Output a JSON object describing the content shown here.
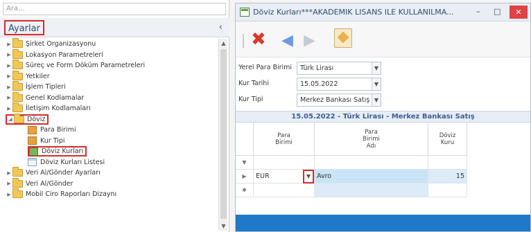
{
  "left": {
    "search_placeholder": "Ara...",
    "panel_title": "Ayarlar",
    "collapse_glyph": "‹",
    "tree": [
      {
        "label": "Şirket Organizasyonu",
        "kind": "folder",
        "expanded": false
      },
      {
        "label": "Lokasyon Parametreleri",
        "kind": "folder",
        "expanded": false
      },
      {
        "label": "Süreç ve Form Döküm Parametreleri",
        "kind": "folder",
        "expanded": false
      },
      {
        "label": "Yetkiler",
        "kind": "folder",
        "expanded": false
      },
      {
        "label": "İşlem Tipleri",
        "kind": "folder",
        "expanded": false
      },
      {
        "label": "Genel Kodlamalar",
        "kind": "folder",
        "expanded": false
      },
      {
        "label": "İletişim Kodlamaları",
        "kind": "folder",
        "expanded": false
      },
      {
        "label": "Döviz",
        "kind": "folder",
        "expanded": true
      },
      {
        "label": "Para Birimi",
        "kind": "leaf",
        "icon": "orange"
      },
      {
        "label": "Kur Tipi",
        "kind": "leaf",
        "icon": "orange"
      },
      {
        "label": "Döviz Kurları",
        "kind": "leaf",
        "icon": "green"
      },
      {
        "label": "Döviz Kurları Listesi",
        "kind": "leaf",
        "icon": "list"
      },
      {
        "label": "Veri Al/Gönder Ayarları",
        "kind": "folder",
        "expanded": false
      },
      {
        "label": "Veri Al/Gönder",
        "kind": "folder",
        "expanded": false
      },
      {
        "label": "Mobil Ciro Raporları Dizaynı",
        "kind": "folder",
        "expanded": false
      }
    ]
  },
  "window": {
    "title": "Döviz Kurları***AKADEMIK LISANS ILE KULLANILMA...",
    "min_glyph": "–",
    "max_glyph": "□",
    "close_glyph": "✕",
    "toolbar": {
      "delete_icon": "delete-x-icon",
      "prev_icon": "arrow-left-icon",
      "next_icon": "arrow-right-icon",
      "wizard_icon": "wand-icon"
    },
    "form": {
      "yerel_label": "Yerel Para Birimi",
      "yerel_value": "Türk Lirası",
      "tarih_label": "Kur Tarihi",
      "tarih_value": "15.05.2022",
      "tip_label": "Kur Tipi",
      "tip_value": "Merkez Bankası Satış",
      "dd_glyph": "▼"
    },
    "grid_caption": "15.05.2022 - Türk Lirası - Merkez Bankası Satış",
    "columns": [
      "Para Birimi",
      "Para Birimi Adı",
      "Döviz Kuru"
    ],
    "filter_glyph": "▼",
    "rows": [
      {
        "indicator": "▶",
        "code": "EUR",
        "name": "Avro",
        "rate": "15"
      }
    ],
    "new_row_glyph": "✱"
  },
  "colors": {
    "accent_blue": "#1f78c8",
    "highlight_red": "#d62b2b",
    "selected_cell": "#c9e4f7"
  }
}
